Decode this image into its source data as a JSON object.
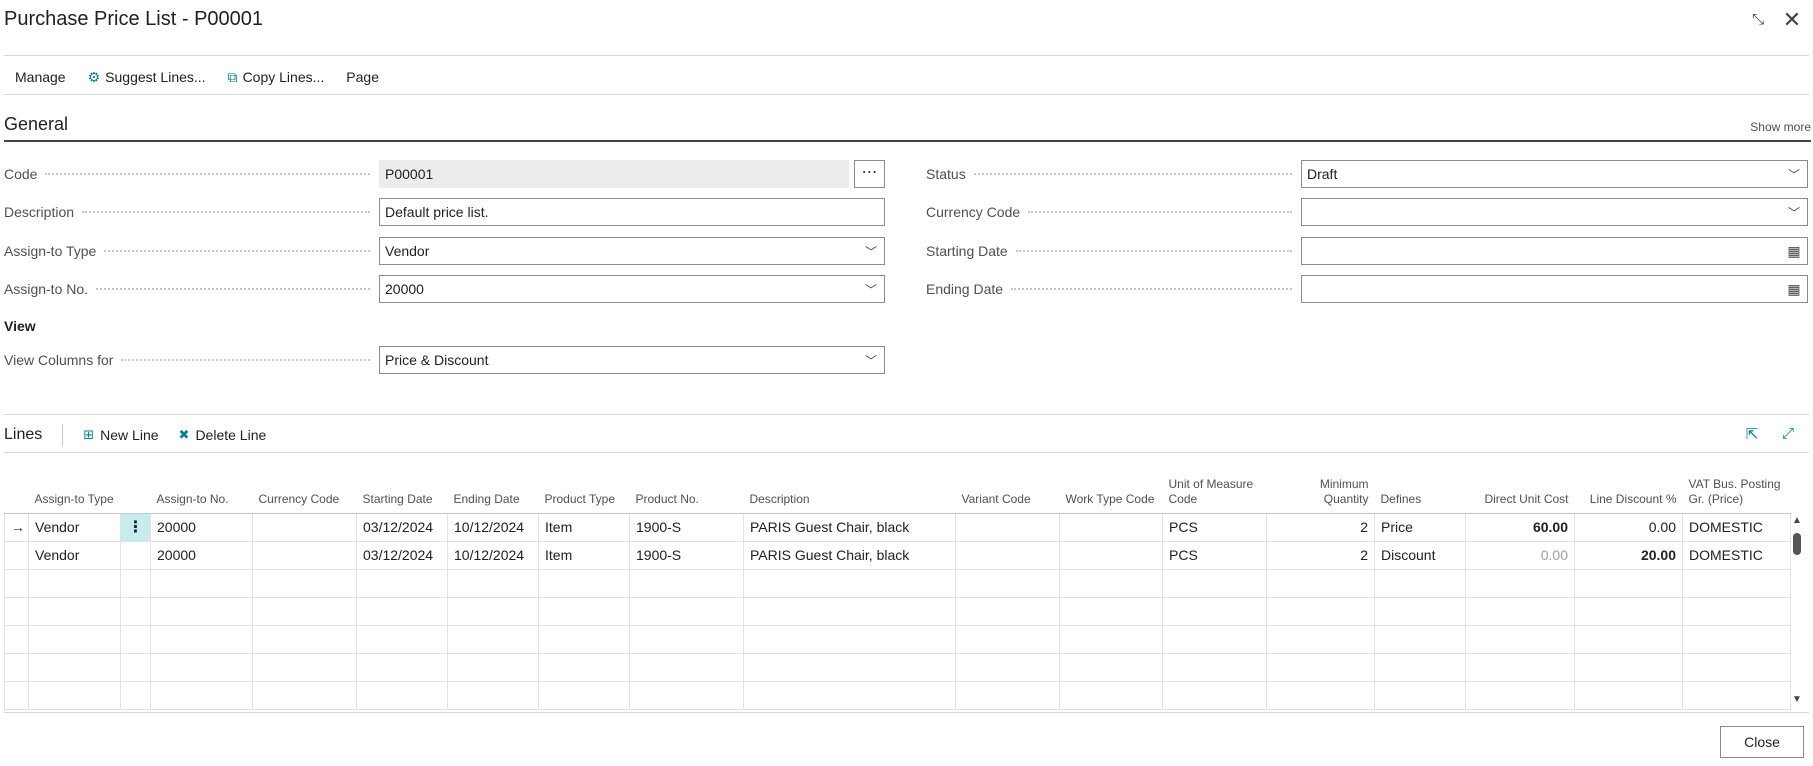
{
  "window": {
    "title": "Purchase Price List - P00001",
    "collapse_icon": "collapse-icon",
    "close_icon": "close-icon"
  },
  "actions": {
    "manage": "Manage",
    "suggest_lines": "Suggest Lines...",
    "copy_lines": "Copy Lines...",
    "page": "Page"
  },
  "general": {
    "title": "General",
    "show_more": "Show more",
    "code_label": "Code",
    "code_value": "P00001",
    "description_label": "Description",
    "description_value": "Default price list.",
    "assign_type_label": "Assign-to Type",
    "assign_type_value": "Vendor",
    "assign_no_label": "Assign-to No.",
    "assign_no_value": "20000",
    "status_label": "Status",
    "status_value": "Draft",
    "currency_label": "Currency Code",
    "currency_value": "",
    "starting_date_label": "Starting Date",
    "starting_date_value": "",
    "ending_date_label": "Ending Date",
    "ending_date_value": "",
    "view_title": "View",
    "view_columns_label": "View Columns for",
    "view_columns_value": "Price & Discount"
  },
  "lines": {
    "title": "Lines",
    "new_line": "New Line",
    "delete_line": "Delete Line",
    "columns": {
      "assign_type": "Assign-to Type",
      "assign_no": "Assign-to No.",
      "currency": "Currency Code",
      "starting_date": "Starting Date",
      "ending_date": "Ending Date",
      "product_type": "Product Type",
      "product_no": "Product No.",
      "description": "Description",
      "variant": "Variant Code",
      "work_type": "Work Type Code",
      "uom": "Unit of Measure Code",
      "min_qty": "Minimum Quantity",
      "defines": "Defines",
      "direct_unit_cost": "Direct Unit Cost",
      "line_discount": "Line Discount %",
      "vat": "VAT Bus. Posting Gr. (Price)"
    },
    "rows": [
      {
        "assign_type": "Vendor",
        "assign_no": "20000",
        "currency": "",
        "starting_date": "03/12/2024",
        "ending_date": "10/12/2024",
        "product_type": "Item",
        "product_no": "1900-S",
        "description": "PARIS Guest Chair, black",
        "variant": "",
        "work_type": "",
        "uom": "PCS",
        "min_qty": "2",
        "defines": "Price",
        "direct_unit_cost": "60.00",
        "line_discount": "0.00",
        "vat": "DOMESTIC"
      },
      {
        "assign_type": "Vendor",
        "assign_no": "20000",
        "currency": "",
        "starting_date": "03/12/2024",
        "ending_date": "10/12/2024",
        "product_type": "Item",
        "product_no": "1900-S",
        "description": "PARIS Guest Chair, black",
        "variant": "",
        "work_type": "",
        "uom": "PCS",
        "min_qty": "2",
        "defines": "Discount",
        "direct_unit_cost": "0.00",
        "line_discount": "20.00",
        "vat": "DOMESTIC"
      }
    ]
  },
  "footer": {
    "close": "Close"
  },
  "colors": {
    "accent": "#00838f",
    "selected_cell": "#c7ecef"
  }
}
